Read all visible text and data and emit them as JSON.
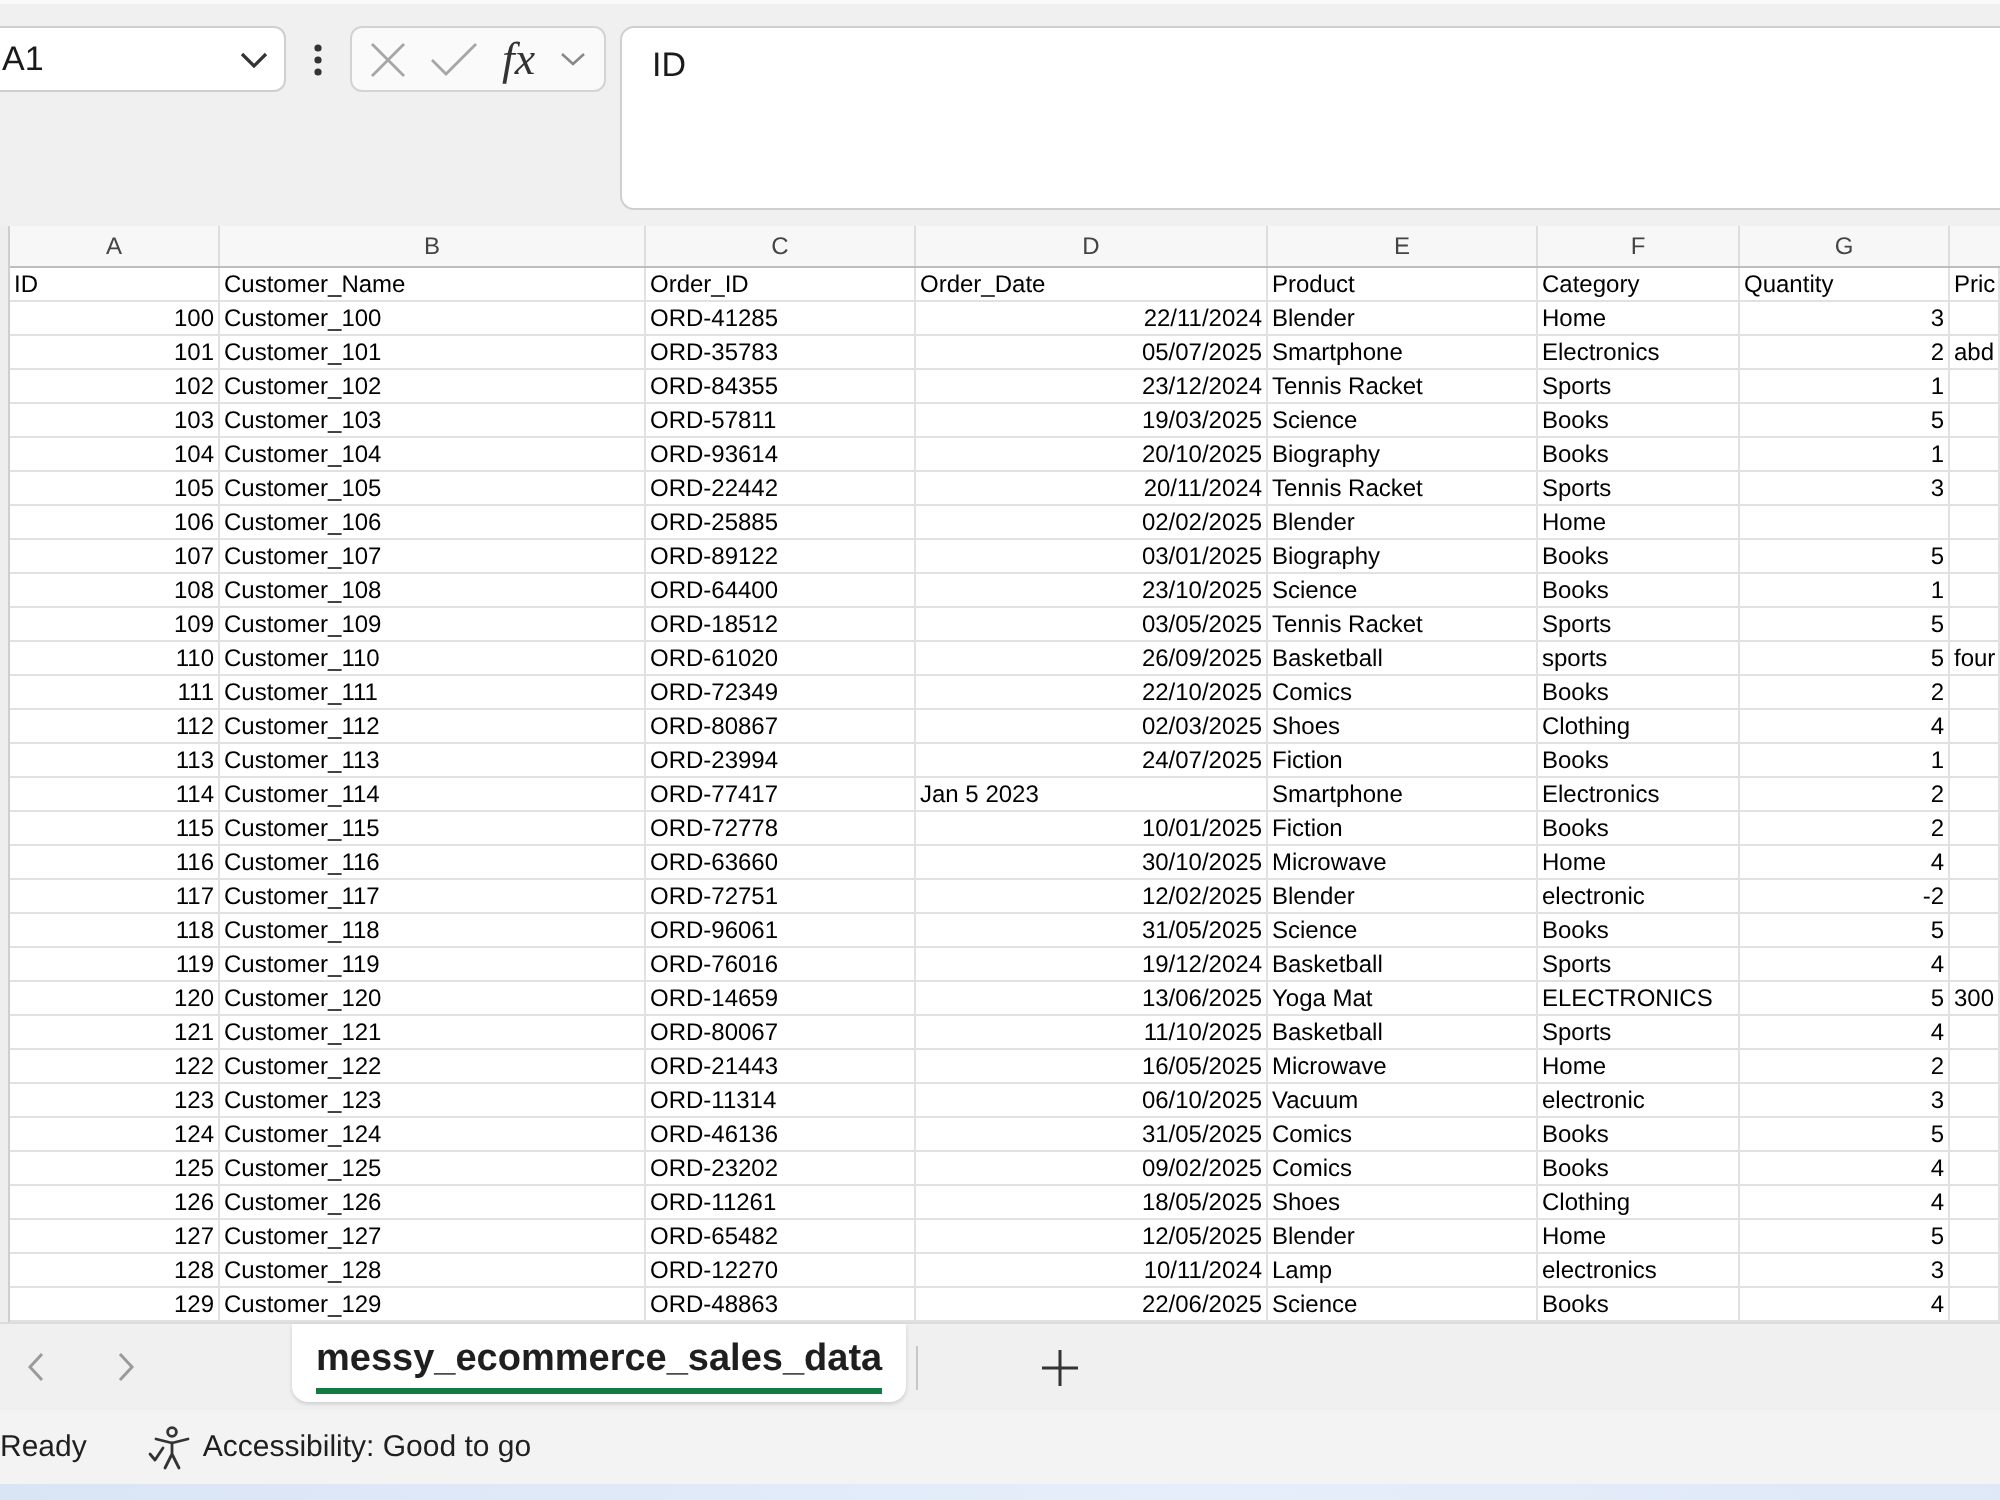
{
  "name_box": {
    "value": "A1"
  },
  "formula_bar": {
    "buttons_enabled": false,
    "function_label": "fx",
    "value": "ID"
  },
  "column_headers": [
    "A",
    "B",
    "C",
    "D",
    "E",
    "F",
    "G"
  ],
  "table": {
    "rows": [
      [
        {
          "text": "ID",
          "kind": "text"
        },
        {
          "text": "Customer_Name",
          "kind": "text"
        },
        {
          "text": "Order_ID",
          "kind": "text"
        },
        {
          "text": "Order_Date",
          "kind": "text"
        },
        {
          "text": "Product",
          "kind": "text"
        },
        {
          "text": "Category",
          "kind": "text"
        },
        {
          "text": "Quantity",
          "kind": "text"
        },
        {
          "text": "Pric",
          "kind": "text"
        }
      ],
      [
        {
          "text": "100",
          "kind": "number"
        },
        {
          "text": "Customer_100",
          "kind": "text"
        },
        {
          "text": "ORD-41285",
          "kind": "text"
        },
        {
          "text": "22/11/2024",
          "kind": "date"
        },
        {
          "text": "Blender",
          "kind": "text"
        },
        {
          "text": "Home",
          "kind": "text"
        },
        {
          "text": "3",
          "kind": "number"
        },
        null
      ],
      [
        {
          "text": "101",
          "kind": "number"
        },
        {
          "text": "Customer_101",
          "kind": "text"
        },
        {
          "text": "ORD-35783",
          "kind": "text"
        },
        {
          "text": "05/07/2025",
          "kind": "date"
        },
        {
          "text": "Smartphone",
          "kind": "text"
        },
        {
          "text": "Electronics",
          "kind": "text"
        },
        {
          "text": "2",
          "kind": "number"
        },
        {
          "text": "abd",
          "kind": "text"
        }
      ],
      [
        {
          "text": "102",
          "kind": "number"
        },
        {
          "text": "Customer_102",
          "kind": "text"
        },
        {
          "text": "ORD-84355",
          "kind": "text"
        },
        {
          "text": "23/12/2024",
          "kind": "date"
        },
        {
          "text": "Tennis Racket",
          "kind": "text"
        },
        {
          "text": "Sports",
          "kind": "text"
        },
        {
          "text": "1",
          "kind": "number"
        },
        null
      ],
      [
        {
          "text": "103",
          "kind": "number"
        },
        {
          "text": "Customer_103",
          "kind": "text"
        },
        {
          "text": "ORD-57811",
          "kind": "text"
        },
        {
          "text": "19/03/2025",
          "kind": "date"
        },
        {
          "text": "Science",
          "kind": "text"
        },
        {
          "text": "Books",
          "kind": "text"
        },
        {
          "text": "5",
          "kind": "number"
        },
        null
      ],
      [
        {
          "text": "104",
          "kind": "number"
        },
        {
          "text": "Customer_104",
          "kind": "text"
        },
        {
          "text": "ORD-93614",
          "kind": "text"
        },
        {
          "text": "20/10/2025",
          "kind": "date"
        },
        {
          "text": "Biography",
          "kind": "text"
        },
        {
          "text": "Books",
          "kind": "text"
        },
        {
          "text": "1",
          "kind": "number"
        },
        null
      ],
      [
        {
          "text": "105",
          "kind": "number"
        },
        {
          "text": "Customer_105",
          "kind": "text"
        },
        {
          "text": "ORD-22442",
          "kind": "text"
        },
        {
          "text": "20/11/2024",
          "kind": "date"
        },
        {
          "text": "Tennis Racket",
          "kind": "text"
        },
        {
          "text": "Sports",
          "kind": "text"
        },
        {
          "text": "3",
          "kind": "number"
        },
        null
      ],
      [
        {
          "text": "106",
          "kind": "number"
        },
        {
          "text": "Customer_106",
          "kind": "text"
        },
        {
          "text": "ORD-25885",
          "kind": "text"
        },
        {
          "text": "02/02/2025",
          "kind": "date"
        },
        {
          "text": "Blender",
          "kind": "text"
        },
        {
          "text": "Home",
          "kind": "text"
        },
        null,
        null
      ],
      [
        {
          "text": "107",
          "kind": "number"
        },
        {
          "text": "Customer_107",
          "kind": "text"
        },
        {
          "text": "ORD-89122",
          "kind": "text"
        },
        {
          "text": "03/01/2025",
          "kind": "date"
        },
        {
          "text": "Biography",
          "kind": "text"
        },
        {
          "text": "Books",
          "kind": "text"
        },
        {
          "text": "5",
          "kind": "number"
        },
        null
      ],
      [
        {
          "text": "108",
          "kind": "number"
        },
        {
          "text": "Customer_108",
          "kind": "text"
        },
        {
          "text": "ORD-64400",
          "kind": "text"
        },
        {
          "text": "23/10/2025",
          "kind": "date"
        },
        {
          "text": "Science",
          "kind": "text"
        },
        {
          "text": "Books",
          "kind": "text"
        },
        {
          "text": "1",
          "kind": "number"
        },
        null
      ],
      [
        {
          "text": "109",
          "kind": "number"
        },
        {
          "text": "Customer_109",
          "kind": "text"
        },
        {
          "text": "ORD-18512",
          "kind": "text"
        },
        {
          "text": "03/05/2025",
          "kind": "date"
        },
        {
          "text": "Tennis Racket",
          "kind": "text"
        },
        {
          "text": "Sports",
          "kind": "text"
        },
        {
          "text": "5",
          "kind": "number"
        },
        null
      ],
      [
        {
          "text": "110",
          "kind": "number"
        },
        {
          "text": "Customer_110",
          "kind": "text"
        },
        {
          "text": "ORD-61020",
          "kind": "text"
        },
        {
          "text": "26/09/2025",
          "kind": "date"
        },
        {
          "text": "Basketball",
          "kind": "text"
        },
        {
          "text": "sports",
          "kind": "text"
        },
        {
          "text": "5",
          "kind": "number"
        },
        {
          "text": "four",
          "kind": "text"
        }
      ],
      [
        {
          "text": "111",
          "kind": "number"
        },
        {
          "text": "Customer_111",
          "kind": "text"
        },
        {
          "text": "ORD-72349",
          "kind": "text"
        },
        {
          "text": "22/10/2025",
          "kind": "date"
        },
        {
          "text": "Comics",
          "kind": "text"
        },
        {
          "text": "Books",
          "kind": "text"
        },
        {
          "text": "2",
          "kind": "number"
        },
        null
      ],
      [
        {
          "text": "112",
          "kind": "number"
        },
        {
          "text": "Customer_112",
          "kind": "text"
        },
        {
          "text": "ORD-80867",
          "kind": "text"
        },
        {
          "text": "02/03/2025",
          "kind": "date"
        },
        {
          "text": "Shoes",
          "kind": "text"
        },
        {
          "text": "Clothing",
          "kind": "text"
        },
        {
          "text": "4",
          "kind": "number"
        },
        null
      ],
      [
        {
          "text": "113",
          "kind": "number"
        },
        {
          "text": "Customer_113",
          "kind": "text"
        },
        {
          "text": "ORD-23994",
          "kind": "text"
        },
        {
          "text": "24/07/2025",
          "kind": "date"
        },
        {
          "text": "Fiction",
          "kind": "text"
        },
        {
          "text": "Books",
          "kind": "text"
        },
        {
          "text": "1",
          "kind": "number"
        },
        null
      ],
      [
        {
          "text": "114",
          "kind": "number"
        },
        {
          "text": "Customer_114",
          "kind": "text"
        },
        {
          "text": "ORD-77417",
          "kind": "text"
        },
        {
          "text": "Jan 5 2023",
          "kind": "text"
        },
        {
          "text": "Smartphone",
          "kind": "text"
        },
        {
          "text": "Electronics",
          "kind": "text"
        },
        {
          "text": "2",
          "kind": "number"
        },
        null
      ],
      [
        {
          "text": "115",
          "kind": "number"
        },
        {
          "text": "Customer_115",
          "kind": "text"
        },
        {
          "text": "ORD-72778",
          "kind": "text"
        },
        {
          "text": "10/01/2025",
          "kind": "date"
        },
        {
          "text": "Fiction",
          "kind": "text"
        },
        {
          "text": "Books",
          "kind": "text"
        },
        {
          "text": "2",
          "kind": "number"
        },
        null
      ],
      [
        {
          "text": "116",
          "kind": "number"
        },
        {
          "text": "Customer_116",
          "kind": "text"
        },
        {
          "text": "ORD-63660",
          "kind": "text"
        },
        {
          "text": "30/10/2025",
          "kind": "date"
        },
        {
          "text": "Microwave",
          "kind": "text"
        },
        {
          "text": "Home",
          "kind": "text"
        },
        {
          "text": "4",
          "kind": "number"
        },
        null
      ],
      [
        {
          "text": "117",
          "kind": "number"
        },
        {
          "text": "Customer_117",
          "kind": "text"
        },
        {
          "text": "ORD-72751",
          "kind": "text"
        },
        {
          "text": "12/02/2025",
          "kind": "date"
        },
        {
          "text": "Blender",
          "kind": "text"
        },
        {
          "text": "electronic",
          "kind": "text"
        },
        {
          "text": "-2",
          "kind": "number"
        },
        null
      ],
      [
        {
          "text": "118",
          "kind": "number"
        },
        {
          "text": "Customer_118",
          "kind": "text"
        },
        {
          "text": "ORD-96061",
          "kind": "text"
        },
        {
          "text": "31/05/2025",
          "kind": "date"
        },
        {
          "text": "Science",
          "kind": "text"
        },
        {
          "text": "Books",
          "kind": "text"
        },
        {
          "text": "5",
          "kind": "number"
        },
        null
      ],
      [
        {
          "text": "119",
          "kind": "number"
        },
        {
          "text": "Customer_119",
          "kind": "text"
        },
        {
          "text": "ORD-76016",
          "kind": "text"
        },
        {
          "text": "19/12/2024",
          "kind": "date"
        },
        {
          "text": "Basketball",
          "kind": "text"
        },
        {
          "text": "Sports",
          "kind": "text"
        },
        {
          "text": "4",
          "kind": "number"
        },
        null
      ],
      [
        {
          "text": "120",
          "kind": "number"
        },
        {
          "text": "Customer_120",
          "kind": "text"
        },
        {
          "text": "ORD-14659",
          "kind": "text"
        },
        {
          "text": "13/06/2025",
          "kind": "date"
        },
        {
          "text": "Yoga Mat",
          "kind": "text"
        },
        {
          "text": "ELECTRONICS",
          "kind": "text"
        },
        {
          "text": "5",
          "kind": "number"
        },
        {
          "text": "300",
          "kind": "text"
        }
      ],
      [
        {
          "text": "121",
          "kind": "number"
        },
        {
          "text": "Customer_121",
          "kind": "text"
        },
        {
          "text": "ORD-80067",
          "kind": "text"
        },
        {
          "text": "11/10/2025",
          "kind": "date"
        },
        {
          "text": "Basketball",
          "kind": "text"
        },
        {
          "text": "Sports",
          "kind": "text"
        },
        {
          "text": "4",
          "kind": "number"
        },
        null
      ],
      [
        {
          "text": "122",
          "kind": "number"
        },
        {
          "text": "Customer_122",
          "kind": "text"
        },
        {
          "text": "ORD-21443",
          "kind": "text"
        },
        {
          "text": "16/05/2025",
          "kind": "date"
        },
        {
          "text": "Microwave",
          "kind": "text"
        },
        {
          "text": "Home",
          "kind": "text"
        },
        {
          "text": "2",
          "kind": "number"
        },
        null
      ],
      [
        {
          "text": "123",
          "kind": "number"
        },
        {
          "text": "Customer_123",
          "kind": "text"
        },
        {
          "text": "ORD-11314",
          "kind": "text"
        },
        {
          "text": "06/10/2025",
          "kind": "date"
        },
        {
          "text": "Vacuum",
          "kind": "text"
        },
        {
          "text": "electronic",
          "kind": "text"
        },
        {
          "text": "3",
          "kind": "number"
        },
        null
      ],
      [
        {
          "text": "124",
          "kind": "number"
        },
        {
          "text": "Customer_124",
          "kind": "text"
        },
        {
          "text": "ORD-46136",
          "kind": "text"
        },
        {
          "text": "31/05/2025",
          "kind": "date"
        },
        {
          "text": "Comics",
          "kind": "text"
        },
        {
          "text": "Books",
          "kind": "text"
        },
        {
          "text": "5",
          "kind": "number"
        },
        null
      ],
      [
        {
          "text": "125",
          "kind": "number"
        },
        {
          "text": "Customer_125",
          "kind": "text"
        },
        {
          "text": "ORD-23202",
          "kind": "text"
        },
        {
          "text": "09/02/2025",
          "kind": "date"
        },
        {
          "text": "Comics",
          "kind": "text"
        },
        {
          "text": "Books",
          "kind": "text"
        },
        {
          "text": "4",
          "kind": "number"
        },
        null
      ],
      [
        {
          "text": "126",
          "kind": "number"
        },
        {
          "text": "Customer_126",
          "kind": "text"
        },
        {
          "text": "ORD-11261",
          "kind": "text"
        },
        {
          "text": "18/05/2025",
          "kind": "date"
        },
        {
          "text": "Shoes",
          "kind": "text"
        },
        {
          "text": "Clothing",
          "kind": "text"
        },
        {
          "text": "4",
          "kind": "number"
        },
        null
      ],
      [
        {
          "text": "127",
          "kind": "number"
        },
        {
          "text": "Customer_127",
          "kind": "text"
        },
        {
          "text": "ORD-65482",
          "kind": "text"
        },
        {
          "text": "12/05/2025",
          "kind": "date"
        },
        {
          "text": "Blender",
          "kind": "text"
        },
        {
          "text": "Home",
          "kind": "text"
        },
        {
          "text": "5",
          "kind": "number"
        },
        null
      ],
      [
        {
          "text": "128",
          "kind": "number"
        },
        {
          "text": "Customer_128",
          "kind": "text"
        },
        {
          "text": "ORD-12270",
          "kind": "text"
        },
        {
          "text": "10/11/2024",
          "kind": "date"
        },
        {
          "text": "Lamp",
          "kind": "text"
        },
        {
          "text": "electronics",
          "kind": "text"
        },
        {
          "text": "3",
          "kind": "number"
        },
        null
      ],
      [
        {
          "text": "129",
          "kind": "number"
        },
        {
          "text": "Customer_129",
          "kind": "text"
        },
        {
          "text": "ORD-48863",
          "kind": "text"
        },
        {
          "text": "22/06/2025",
          "kind": "date"
        },
        {
          "text": "Science",
          "kind": "text"
        },
        {
          "text": "Books",
          "kind": "text"
        },
        {
          "text": "4",
          "kind": "number"
        },
        null
      ]
    ]
  },
  "sheet_tabs": [
    {
      "label": "messy_ecommerce_sales_data",
      "selected": true
    }
  ],
  "status_bar": {
    "mode": "Ready",
    "accessibility": "Accessibility: Good to go"
  }
}
